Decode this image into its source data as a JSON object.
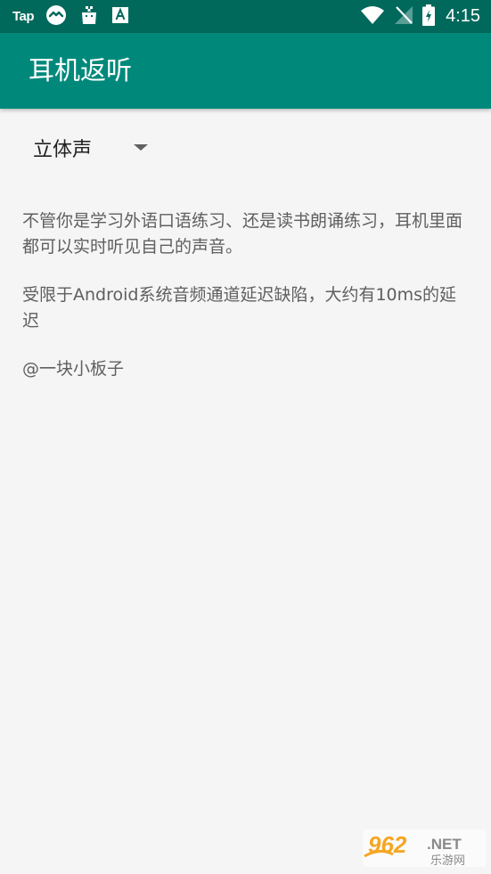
{
  "status_bar": {
    "left_label": "Tap",
    "time": "4:15",
    "icons": [
      "taptap-icon",
      "bag-icon",
      "font-a-icon",
      "wifi-icon",
      "no-signal-icon",
      "battery-charging-icon"
    ]
  },
  "app_bar": {
    "title": "耳机返听"
  },
  "spinner": {
    "selected_value": "立体声"
  },
  "content": {
    "paragraph_1": "不管你是学习外语口语练习、还是读书朗诵练习，耳机里面都可以实时听见自己的声音。",
    "paragraph_2": " 受限于Android系统音频通道延迟缺陷，大约有10ms的延迟",
    "paragraph_3": " @一块小板子"
  },
  "watermark": {
    "brand_number": "962",
    "brand_suffix": ".NET",
    "brand_cn": "乐游网"
  },
  "colors": {
    "status_bar": "#00695c",
    "app_bar": "#00897b",
    "background": "#f5f5f5",
    "body_text": "#5f5f5f"
  }
}
